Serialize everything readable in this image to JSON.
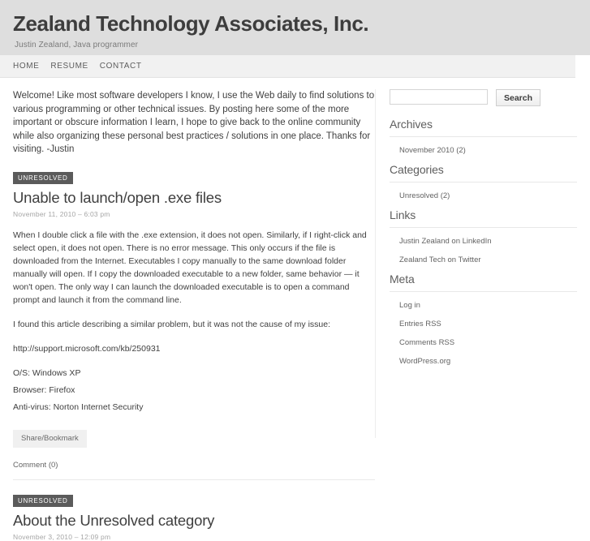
{
  "header": {
    "title": "Zealand Technology Associates, Inc.",
    "tagline": "Justin Zealand, Java programmer"
  },
  "nav": {
    "items": [
      {
        "label": "HOME"
      },
      {
        "label": "RESUME"
      },
      {
        "label": "CONTACT"
      }
    ]
  },
  "main": {
    "intro": "Welcome! Like most software developers I know, I use the Web daily to find solutions to various programming or other technical issues. By posting here some of the more important or obscure information I learn, I hope to give back to the online community while also organizing these personal best practices / solutions in one place. Thanks for visiting.  -Justin",
    "posts": [
      {
        "category": "UNRESOLVED",
        "title": "Unable to launch/open .exe files",
        "date": "November 11, 2010 – 6:03 pm",
        "paragraphs": [
          "When I double click a file with the .exe extension, it does not open. Similarly, if I right-click and select open, it does not open. There is no error message. This only occurs if the file is downloaded from the Internet. Executables I copy manually to the same download folder manually will open. If I copy the downloaded executable to a new folder, same behavior — it won't open. The only way I can launch the downloaded executable is to open a command prompt and launch it from the command line.",
          "I found this article describing a similar problem, but it was not the cause of my issue:"
        ],
        "link": "http://support.microsoft.com/kb/250931",
        "specs": [
          "O/S: Windows XP",
          "Browser: Firefox",
          "Anti-virus: Norton Internet Security"
        ],
        "share_label": "Share/Bookmark",
        "comment_label": "Comment (0)"
      },
      {
        "category": "UNRESOLVED",
        "title": "About the Unresolved category",
        "date": "November 3, 2010 – 12:09 pm"
      }
    ]
  },
  "sidebar": {
    "search": {
      "value": "",
      "placeholder": "",
      "button_label": "Search"
    },
    "widgets": [
      {
        "title": "Archives",
        "items": [
          {
            "label": "November 2010 (2)"
          }
        ]
      },
      {
        "title": "Categories",
        "items": [
          {
            "label": "Unresolved (2)"
          }
        ]
      },
      {
        "title": "Links",
        "items": [
          {
            "label": "Justin Zealand on LinkedIn"
          },
          {
            "label": "Zealand Tech on Twitter"
          }
        ]
      },
      {
        "title": "Meta",
        "items": [
          {
            "label": "Log in"
          },
          {
            "label": "Entries RSS"
          },
          {
            "label": "Comments RSS"
          },
          {
            "label": "WordPress.org"
          }
        ]
      }
    ]
  },
  "colors": {
    "header_bg": "#dedede",
    "nav_bg": "#f1f1f1",
    "badge_bg": "#5b5b5b",
    "text": "#333333"
  }
}
